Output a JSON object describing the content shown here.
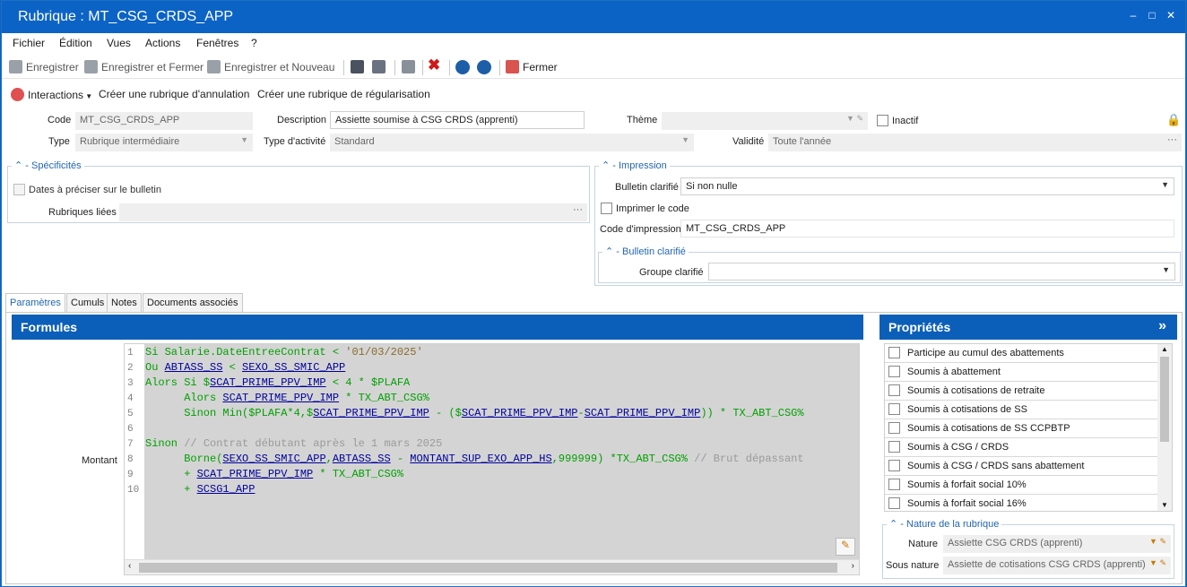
{
  "window": {
    "title": "Rubrique : MT_CSG_CRDS_APP",
    "min": "–",
    "max": "□",
    "close": "✕"
  },
  "menu": [
    "Fichier",
    "Édition",
    "Vues",
    "Actions",
    "Fenêtres",
    "?"
  ],
  "toolbar": {
    "save": "Enregistrer",
    "save_close": "Enregistrer et Fermer",
    "save_new": "Enregistrer et Nouveau",
    "close": "Fermer"
  },
  "actions": {
    "interactions": "Interactions",
    "cancel_rubric": "Créer une rubrique d'annulation",
    "regul_rubric": "Créer une rubrique de régularisation"
  },
  "form": {
    "code_label": "Code",
    "code": "MT_CSG_CRDS_APP",
    "desc_label": "Description",
    "desc": "Assiette soumise à CSG CRDS (apprenti)",
    "theme_label": "Thème",
    "theme": "",
    "inactive_label": "Inactif",
    "type_label": "Type",
    "type": "Rubrique intermédiaire",
    "activity_label": "Type d'activité",
    "activity": "Standard",
    "validity_label": "Validité",
    "validity": "Toute l'année"
  },
  "specifics": {
    "title": "Spécificités",
    "dates": "Dates à préciser sur le bulletin",
    "linked_label": "Rubriques liées",
    "linked": ""
  },
  "impression": {
    "title": "Impression",
    "bulletin_label": "Bulletin clarifié",
    "bulletin": "Si non nulle",
    "print_code": "Imprimer le code",
    "code_label": "Code d'impression",
    "code": "MT_CSG_CRDS_APP",
    "clar_title": "Bulletin clarifié",
    "group_label": "Groupe clarifié",
    "group": ""
  },
  "tabs": [
    "Paramètres",
    "Cumuls",
    "Notes",
    "Documents associés"
  ],
  "formulas": {
    "title": "Formules",
    "montant_label": "Montant",
    "line_numbers": [
      "1",
      "2",
      "3",
      "4",
      "5",
      "6",
      "7",
      "8",
      "9",
      "10"
    ]
  },
  "properties": {
    "title": "Propriétés",
    "expand": "»",
    "items": [
      "Participe au cumul des abattements",
      "Soumis à abattement",
      "Soumis à cotisations de retraite",
      "Soumis à cotisations de SS",
      "Soumis à cotisations de SS CCPBTP",
      "Soumis à CSG / CRDS",
      "Soumis à CSG / CRDS sans abattement",
      "Soumis à forfait social 10%",
      "Soumis à forfait social 16%"
    ]
  },
  "nature": {
    "title": "Nature de la rubrique",
    "nature_label": "Nature",
    "nature": "Assiette CSG CRDS (apprenti)",
    "subnature_label": "Sous nature",
    "subnature": "Assiette de cotisations CSG CRDS (apprenti)"
  }
}
